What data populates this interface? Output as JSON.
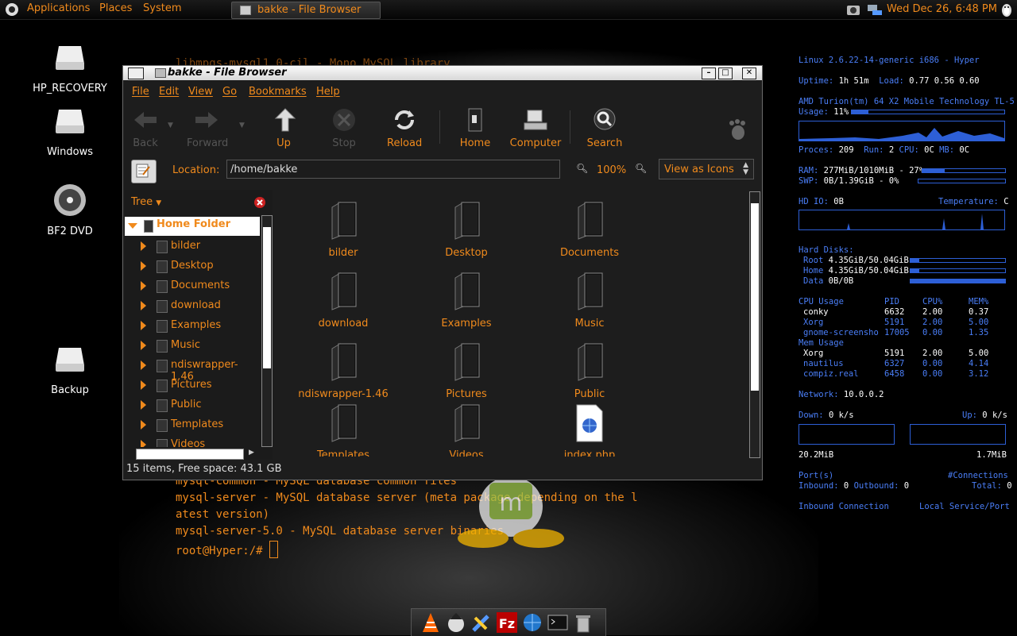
{
  "panel": {
    "menus": [
      "Applications",
      "Places",
      "System"
    ],
    "task_title": "bakke - File Browser",
    "clock": "Wed Dec 26,  6:48 PM"
  },
  "desktop_icons": [
    "HP_RECOVERY",
    "Windows",
    "BF2 DVD",
    "Backup"
  ],
  "terminal": {
    "line0": "libmpqs-mysql1.0-cil - Mono MySQL library",
    "line1": "mysql-common - MySQL database common files",
    "line2": "mysql-server - MySQL database server (meta package depending on the l",
    "line3": "atest version)",
    "line4": "mysql-server-5.0 - MySQL database server binaries",
    "prompt": "root@Hyper:/# "
  },
  "window": {
    "title": "bakke - File Browser",
    "menu": [
      "File",
      "Edit",
      "View",
      "Go",
      "Bookmarks",
      "Help"
    ],
    "toolbar": {
      "back": "Back",
      "forward": "Forward",
      "up": "Up",
      "stop": "Stop",
      "reload": "Reload",
      "home": "Home",
      "computer": "Computer",
      "search": "Search"
    },
    "location_label": "Location:",
    "location_value": "/home/bakke",
    "zoom": "100%",
    "view_as": "View as Icons",
    "sidebar_mode": "Tree",
    "tree_root": "Home Folder",
    "tree": [
      "bilder",
      "Desktop",
      "Documents",
      "download",
      "Examples",
      "Music",
      "ndiswrapper-1.46",
      "Pictures",
      "Public",
      "Templates",
      "Videos"
    ],
    "files": [
      "bilder",
      "Desktop",
      "Documents",
      "download",
      "Examples",
      "Music",
      "ndiswrapper-1.46",
      "Pictures",
      "Public",
      "Templates",
      "Videos",
      "index.php"
    ],
    "status": "15 items, Free space: 43.1 GB"
  },
  "conky": {
    "kernel": "Linux 2.6.22-14-generic i686 - Hyper",
    "uptime_label": "Uptime:",
    "uptime": "1h 51m",
    "load_label": "Load:",
    "load": "0.77 0.56 0.60",
    "cpu_name": "AMD Turion(tm) 64 X2 Mobile Technology TL-5",
    "usage_label": "Usage:",
    "usage": "11%",
    "usage_fraction": 0.11,
    "procs_label": "Proces:",
    "procs": "209",
    "run_label": "Run:",
    "run": "2",
    "cpu_temp_label": "CPU:",
    "cpu_temp": "0C",
    "mb_label": "MB:",
    "mb_temp": "0C",
    "ram_label": "RAM:",
    "ram": "277MiB/1010MiB - 27%",
    "ram_fraction": 0.27,
    "swp_label": "SWP:",
    "swp": "0B/1.39GiB - 0%",
    "swp_fraction": 0.0,
    "hdio_label": "HD IO:",
    "hdio": "0B",
    "temp_label": "Temperature:",
    "temp": "C",
    "disks_label": "Hard Disks:",
    "disks": [
      {
        "name": "Root",
        "value": "4.35GiB/50.04GiB",
        "fraction": 0.09
      },
      {
        "name": "Home",
        "value": "4.35GiB/50.04GiB",
        "fraction": 0.09
      },
      {
        "name": "Data",
        "value": "0B/0B",
        "fraction": 1.0
      }
    ],
    "cpu_head": [
      "CPU Usage",
      "PID",
      "CPU%",
      "MEM%"
    ],
    "cpu_rows": [
      [
        "conky",
        "6632",
        "2.00",
        "0.37"
      ],
      [
        "Xorg",
        "5191",
        "2.00",
        "5.00"
      ],
      [
        "gnome-screensho",
        "17005",
        "0.00",
        "1.35"
      ]
    ],
    "mem_head": "Mem Usage",
    "mem_rows": [
      [
        "Xorg",
        "5191",
        "2.00",
        "5.00"
      ],
      [
        "nautilus",
        "6327",
        "0.00",
        "4.14"
      ],
      [
        "compiz.real",
        "6458",
        "0.00",
        "3.12"
      ]
    ],
    "network_label": "Network:",
    "network": "10.0.0.2",
    "down_label": "Down:",
    "down": "0 k/s",
    "up_label": "Up:",
    "up": "0 k/s",
    "down_total": "20.2MiB",
    "up_total": "1.7MiB",
    "ports_label": "Port(s)",
    "connections_label": "#Connections",
    "inbound_label": "Inbound:",
    "inbound": "0",
    "outbound_label": "Outbound:",
    "outbound": "0",
    "total_label": "Total:",
    "total": "0",
    "inbound_conn": "Inbound Connection",
    "local_service": "Local Service/Port"
  },
  "colors": {
    "accent": "#f08a1c",
    "conky": "#4a7ef7"
  }
}
